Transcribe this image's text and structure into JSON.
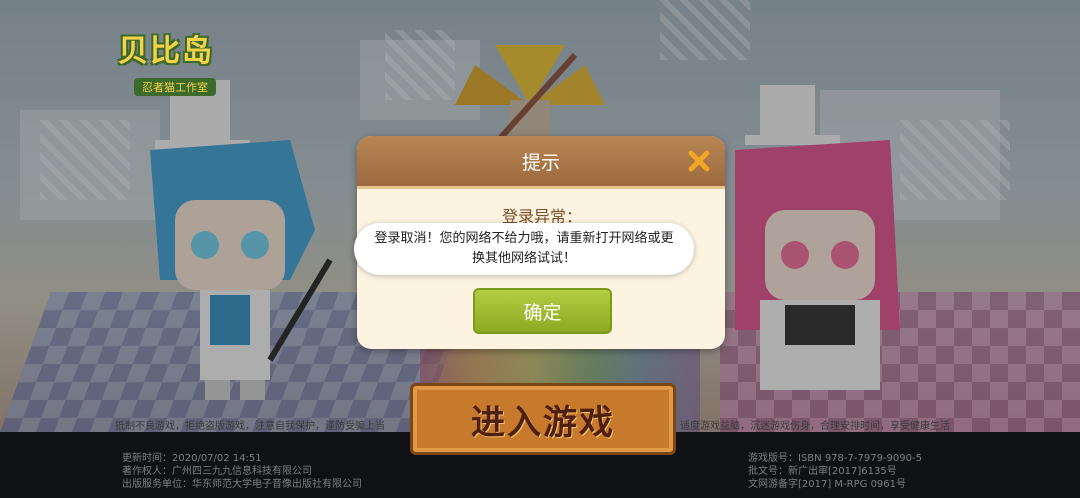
{
  "logo": {
    "title": "贝比岛",
    "subtitle": "忍者猫工作室"
  },
  "notice": {
    "left": "抵制不良游戏，拒绝盗版游戏，注意自我保护，谨防受骗上当",
    "right": "适度游戏益脑，沉迷游戏伤身，合理安排时间，享受健康生活"
  },
  "enter_button": {
    "label": "进入游戏"
  },
  "footer": {
    "left": [
      "更新时间：2020/07/02 14:51",
      "著作权人：广州四三九九信息科技有限公司",
      "出版服务单位：华东师范大学电子音像出版社有限公司"
    ],
    "right": [
      "游戏版号：ISBN 978-7-7979-9090-5",
      "批文号：新广出审[2017]6135号",
      "文网游备字[2017] M-RPG 0961号"
    ]
  },
  "dialog": {
    "title": "提示",
    "message": "登录异常：",
    "confirm_label": "确定"
  },
  "toast": {
    "message": "登录取消！您的网络不给力哦，请重新打开网络或更换其他网络试试！"
  },
  "colors": {
    "dialog_header": "#a9754a",
    "confirm": "#9fbd2f",
    "close_icon": "#f2a623"
  }
}
